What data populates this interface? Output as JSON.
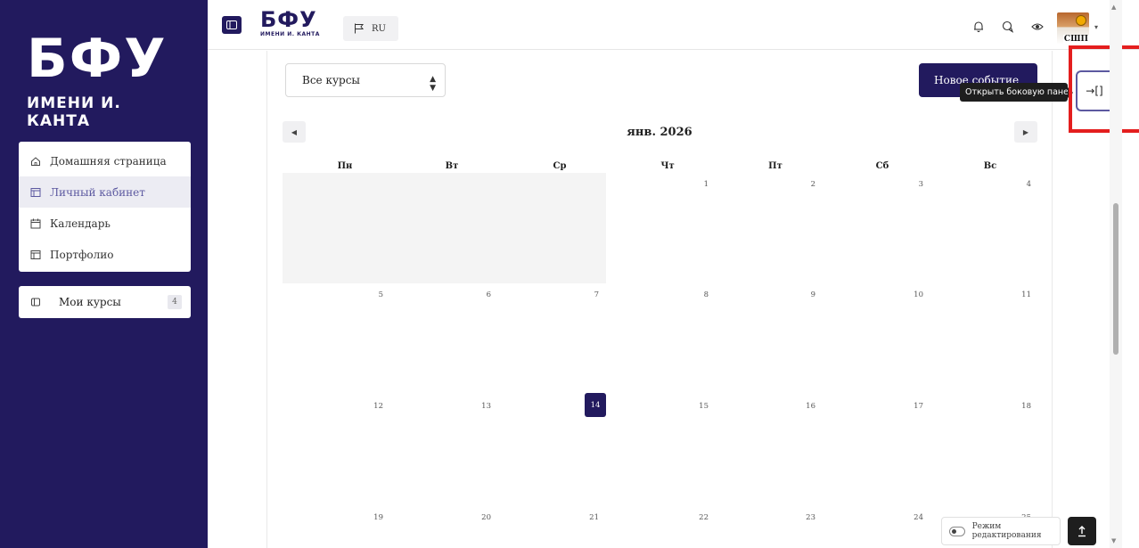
{
  "sidebar": {
    "logo_big": "БФУ",
    "logo_sub": "ИМЕНИ И. КАНТА",
    "items": [
      {
        "label": "Домашняя страница",
        "icon": "home-icon"
      },
      {
        "label": "Личный кабинет",
        "icon": "dashboard-icon",
        "active": true
      },
      {
        "label": "Календарь",
        "icon": "calendar-icon"
      },
      {
        "label": "Портфолио",
        "icon": "portfolio-icon"
      }
    ],
    "my_courses": {
      "label": "Мои курсы",
      "count": "4",
      "icon": "courses-icon"
    }
  },
  "header": {
    "logo_big": "БФУ",
    "logo_sub": "ИМЕНИ И. КАНТА",
    "language": "RU",
    "avatar_label": "СШП",
    "icons": [
      "bell-icon",
      "chat-icon",
      "eye-icon"
    ]
  },
  "toolbar": {
    "course_filter": "Все курсы",
    "new_event_label": "Новое событие",
    "tooltip": "Открыть боковую панель",
    "drawer_button_icon": "drawer-open-icon"
  },
  "calendar": {
    "month_label": "янв. 2026",
    "weekdays": [
      "Пн",
      "Вт",
      "Ср",
      "Чт",
      "Пт",
      "Сб",
      "Вс"
    ],
    "weeks": [
      [
        "",
        "",
        "",
        "1",
        "2",
        "3",
        "4"
      ],
      [
        "5",
        "6",
        "7",
        "8",
        "9",
        "10",
        "11"
      ],
      [
        "12",
        "13",
        "14",
        "15",
        "16",
        "17",
        "18"
      ],
      [
        "19",
        "20",
        "21",
        "22",
        "23",
        "24",
        "25"
      ]
    ],
    "today": "14"
  },
  "footer": {
    "edit_mode_label": "Режим редактирования",
    "edit_mode_on": false
  },
  "colors": {
    "brand": "#221a5e",
    "accent": "#5c59a0",
    "highlight": "#e41e1e"
  }
}
